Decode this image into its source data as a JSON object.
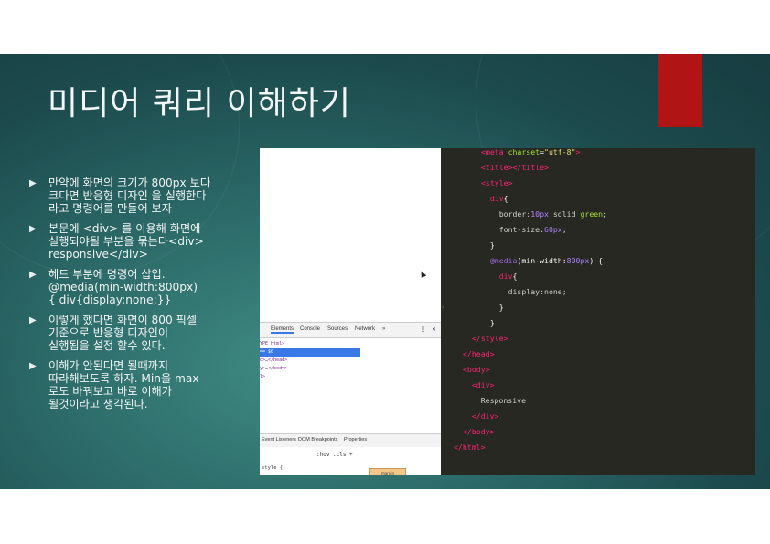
{
  "slide": {
    "title": "미디어 쿼리 이해하기",
    "accent_color": "#b01414",
    "bullets": [
      {
        "lines": [
          "만약에 화면의 크기가 800px 보다",
          "크다면 반응형 디자인 을 실행한다",
          "라고 명령어를 만들어 보자"
        ]
      },
      {
        "lines": [
          "본문에 <div> 를 이용해 화면에",
          "실행되야될 부분을 묶는다<div>",
          "responsive</div>"
        ]
      },
      {
        "lines": [
          "헤드 부분에 명령어 삽입.",
          "@media(min-width:800px)",
          "{ div{display:none;}}"
        ]
      },
      {
        "lines": [
          "이렇게 했다면 화면이 800 픽셀",
          "기준으로 반응형 디자인이",
          "실행됨을 설정 할수 있다."
        ]
      },
      {
        "lines": [
          "이해가 안된다면 될때까지",
          "따라해보도록 하자. Min을 max",
          "로도 바꿔보고 바로 이해가",
          "될것이라고 생각된다."
        ]
      }
    ]
  },
  "devtools": {
    "tabs": [
      "Elements",
      "Console",
      "Sources",
      "Network",
      "»"
    ],
    "menu_icon": "vertical-dots-icon",
    "close_icon": "close-icon",
    "dom_lines": [
      "YPE html>",
      "== $0",
      "d>…</head>",
      "y>…</body>",
      "l>"
    ],
    "bottom_tabs": [
      "Event Listeners",
      "DOM Breakpoints",
      "Properties"
    ],
    "filter_hov": ":hov",
    "filter_cls": ".cls",
    "filter_add": "+",
    "style_rule": "style {",
    "box_model_label": "margin"
  },
  "editor": {
    "lines": [
      [
        {
          "c": "t",
          "v": "<meta "
        },
        {
          "c": "a",
          "v": "charset"
        },
        {
          "c": "p",
          "v": "="
        },
        {
          "c": "s",
          "v": "\"utf-8\""
        },
        {
          "c": "t",
          "v": ">"
        }
      ],
      [
        {
          "c": "t",
          "v": "<title></title>"
        }
      ],
      [
        {
          "c": "t",
          "v": "<style>"
        }
      ],
      [
        {
          "c": "p",
          "v": "  "
        },
        {
          "c": "t",
          "v": "div"
        },
        {
          "c": "p",
          "v": "{"
        }
      ],
      [
        {
          "c": "p",
          "v": "    "
        },
        {
          "c": "c",
          "v": "border:"
        },
        {
          "c": "n",
          "v": "10px"
        },
        {
          "c": "c",
          "v": " solid "
        },
        {
          "c": "a",
          "v": "green"
        },
        {
          "c": "c",
          "v": ";"
        }
      ],
      [
        {
          "c": "p",
          "v": "    "
        },
        {
          "c": "c",
          "v": "font-size:"
        },
        {
          "c": "n",
          "v": "60px"
        },
        {
          "c": "c",
          "v": ";"
        }
      ],
      [
        {
          "c": "p",
          "v": "  }"
        }
      ],
      [
        {
          "c": "p",
          "v": "  "
        },
        {
          "c": "m",
          "v": "@media"
        },
        {
          "c": "p",
          "v": "(min-width:"
        },
        {
          "c": "n",
          "v": "800px"
        },
        {
          "c": "p",
          "v": ") {"
        }
      ],
      [
        {
          "c": "p",
          "v": "    "
        },
        {
          "c": "t",
          "v": "div"
        },
        {
          "c": "p",
          "v": "{"
        }
      ],
      [
        {
          "c": "p",
          "v": "      "
        },
        {
          "c": "c",
          "v": "display:none;"
        }
      ],
      [
        {
          "c": "p",
          "v": "    }"
        }
      ],
      [
        {
          "c": "p",
          "v": "  }"
        }
      ],
      [
        {
          "c": "t",
          "v": "</style>"
        }
      ],
      [
        {
          "c": "t",
          "v": "</head>"
        }
      ],
      [
        {
          "c": "t",
          "v": "<body>"
        }
      ],
      [
        {
          "c": "p",
          "v": "  "
        },
        {
          "c": "t",
          "v": "<div>"
        }
      ],
      [
        {
          "c": "p",
          "v": "    "
        },
        {
          "c": "c",
          "v": "Responsive"
        }
      ],
      [
        {
          "c": "p",
          "v": "  "
        },
        {
          "c": "t",
          "v": "</div>"
        }
      ],
      [
        {
          "c": "t",
          "v": "</body>"
        }
      ],
      [
        {
          "c": "t",
          "v": "</html>"
        }
      ]
    ],
    "line_indents": [
      3,
      3,
      3,
      3,
      3,
      3,
      3,
      3,
      3,
      3,
      3,
      3,
      2,
      1,
      1,
      1,
      1,
      1,
      1,
      0
    ],
    "gutter_marker": "›"
  }
}
